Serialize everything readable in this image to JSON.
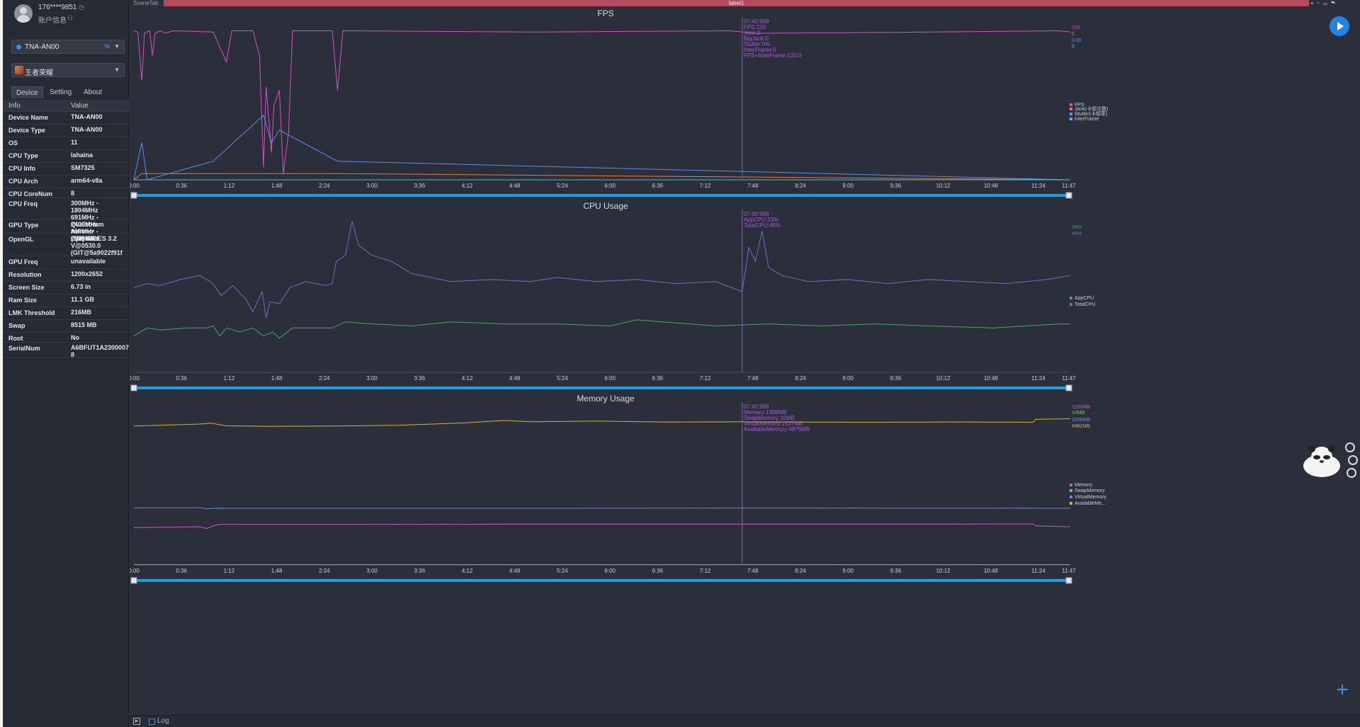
{
  "user": {
    "name": "176****9851",
    "subtitle": "账户信息"
  },
  "device_select": {
    "value": "TNA-AN00"
  },
  "game_select": {
    "value": "王者荣耀"
  },
  "tabs": [
    "Device",
    "Setting",
    "About"
  ],
  "info_table": {
    "headers": [
      "Info",
      "Value"
    ],
    "rows": [
      {
        "k": "Device Name",
        "v": "TNA-AN00",
        "h": 18
      },
      {
        "k": "Device Type",
        "v": "TNA-AN00",
        "h": 18
      },
      {
        "k": "OS",
        "v": "11",
        "h": 18
      },
      {
        "k": "CPU Type",
        "v": "lahaina",
        "h": 18
      },
      {
        "k": "CPU Info",
        "v": "SM7325",
        "h": 18
      },
      {
        "k": "CPU Arch",
        "v": "arm64-v8a",
        "h": 18
      },
      {
        "k": "CPU CoreNum",
        "v": "8",
        "h": 14
      },
      {
        "k": "CPU Freq",
        "v": "300MHz - 1804MHz\n691MHz - 2400MHz\n806MHz - 2515MHz",
        "h": 30
      },
      {
        "k": "GPU Type",
        "v": "Qualcomm Adreno\n(TM) 642L",
        "h": 20
      },
      {
        "k": "OpenGL",
        "v": "OpenGL ES 3.2\nV@0530.0\n(GIT@5a9022f91f",
        "h": 32
      },
      {
        "k": "GPU Freq",
        "v": "unavailable",
        "h": 18
      },
      {
        "k": "Resolution",
        "v": "1200x2652",
        "h": 18
      },
      {
        "k": "Screen Size",
        "v": "6.73 in",
        "h": 18
      },
      {
        "k": "Ram Size",
        "v": "11.1 GB",
        "h": 18
      },
      {
        "k": "LMK Threshold",
        "v": "216MB",
        "h": 18
      },
      {
        "k": "Swap",
        "v": "8515 MB",
        "h": 18
      },
      {
        "k": "Root",
        "v": "No",
        "h": 14
      },
      {
        "k": "SerialNum",
        "v": "A6BFUT1A2300007\n8",
        "h": 22
      }
    ]
  },
  "scene_tab": "SceneTab",
  "label_tab": "label1",
  "bottom": {
    "log_label": "Log"
  },
  "x_ticks": [
    "0:00",
    "0:36",
    "1:12",
    "1:48",
    "2:24",
    "3:00",
    "3:36",
    "4:12",
    "4:48",
    "5:24",
    "6:00",
    "6:36",
    "7:12",
    "7:48",
    "8:24",
    "9:00",
    "9:36",
    "10:12",
    "10:48",
    "11:24",
    "11:47"
  ],
  "chart_data": [
    {
      "type": "line",
      "title": "FPS",
      "ylabel": "FPS",
      "ylim": [
        0,
        130
      ],
      "yticks": [
        0,
        10,
        20,
        30,
        40,
        50,
        60,
        70,
        80,
        90,
        100,
        110,
        120,
        130
      ],
      "x_range": [
        "0:00",
        "11:47"
      ],
      "series": [
        {
          "name": "FPS",
          "color": "#d94fc8",
          "values": [
            [
              0,
              120
            ],
            [
              3,
              119
            ],
            [
              6,
              80
            ],
            [
              8,
              118
            ],
            [
              12,
              120
            ],
            [
              14,
              100
            ],
            [
              16,
              118
            ],
            [
              20,
              120
            ],
            [
              24,
              118
            ],
            [
              30,
              120
            ],
            [
              60,
              119
            ],
            [
              70,
              95
            ],
            [
              74,
              120
            ],
            [
              90,
              120
            ],
            [
              95,
              100
            ],
            [
              98,
              10
            ],
            [
              100,
              75
            ],
            [
              104,
              22
            ],
            [
              106,
              60
            ],
            [
              110,
              72
            ],
            [
              113,
              5
            ],
            [
              117,
              38
            ],
            [
              120,
              120
            ],
            [
              150,
              120
            ],
            [
              154,
              72
            ],
            [
              158,
              120
            ],
            [
              300,
              119
            ],
            [
              450,
              120
            ],
            [
              470,
              118
            ],
            [
              600,
              119
            ],
            [
              700,
              120
            ],
            [
              708,
              119
            ]
          ]
        },
        {
          "name": "Jank",
          "color": "#f07838",
          "values": [
            [
              0,
              0
            ],
            [
              6,
              5
            ],
            [
              10,
              5
            ],
            [
              60,
              5
            ],
            [
              98,
              5
            ],
            [
              110,
              5
            ],
            [
              154,
              5
            ],
            [
              708,
              0
            ]
          ]
        },
        {
          "name": "Stutter",
          "color": "#5c8cf0",
          "values": [
            [
              0,
              0
            ],
            [
              6,
              30
            ],
            [
              10,
              0
            ],
            [
              60,
              15
            ],
            [
              98,
              52
            ],
            [
              104,
              30
            ],
            [
              110,
              40
            ],
            [
              154,
              15
            ],
            [
              708,
              0
            ]
          ]
        },
        {
          "name": "InterFrame",
          "color": "#3ec0e0",
          "values": [
            [
              0,
              0
            ],
            [
              708,
              0
            ]
          ]
        }
      ],
      "legend": [
        "FPS",
        "Jank(卡顿次数)",
        "Stutter(卡顿率)",
        "InterFrame"
      ],
      "current_values": [
        {
          "text": "119",
          "color": "#d94fc8"
        },
        {
          "text": "0",
          "color": "#f07838"
        },
        {
          "text": "0.00",
          "color": "#5c8cf0"
        },
        {
          "text": "0",
          "color": "#3ec0e0"
        }
      ],
      "cursor": {
        "time": "7:40",
        "lines": [
          "07:40:999",
          "FPS:120",
          "Jank:0",
          "BigJank:0",
          "Stutter:0%",
          "InterFrame:0",
          "FPS+InterFrame:120.0"
        ]
      }
    },
    {
      "type": "line",
      "title": "CPU Usage",
      "ylabel": "%",
      "ylim": [
        0,
        80
      ],
      "yticks": [
        0,
        10,
        20,
        30,
        40,
        50,
        60,
        70,
        80
      ],
      "x_range": [
        "0:00",
        "11:47"
      ],
      "series": [
        {
          "name": "AppCPU",
          "color": "#3daa5c",
          "values": [
            [
              0,
              18
            ],
            [
              10,
              22
            ],
            [
              20,
              21
            ],
            [
              40,
              22
            ],
            [
              55,
              22
            ],
            [
              60,
              23
            ],
            [
              65,
              18
            ],
            [
              70,
              22
            ],
            [
              80,
              20
            ],
            [
              90,
              22
            ],
            [
              98,
              18
            ],
            [
              105,
              20
            ],
            [
              110,
              17
            ],
            [
              120,
              22
            ],
            [
              150,
              22
            ],
            [
              160,
              25
            ],
            [
              180,
              24
            ],
            [
              210,
              23
            ],
            [
              240,
              25
            ],
            [
              280,
              24
            ],
            [
              320,
              24
            ],
            [
              360,
              23
            ],
            [
              380,
              26
            ],
            [
              420,
              24
            ],
            [
              440,
              23
            ],
            [
              480,
              24
            ],
            [
              520,
              23
            ],
            [
              560,
              24
            ],
            [
              600,
              23
            ],
            [
              650,
              22
            ],
            [
              700,
              24
            ],
            [
              708,
              24
            ]
          ]
        },
        {
          "name": "TotalCPU",
          "color": "#6670c8",
          "values": [
            [
              0,
              42
            ],
            [
              10,
              44
            ],
            [
              20,
              43
            ],
            [
              35,
              46
            ],
            [
              50,
              48
            ],
            [
              60,
              44
            ],
            [
              66,
              38
            ],
            [
              75,
              43
            ],
            [
              85,
              36
            ],
            [
              90,
              30
            ],
            [
              97,
              40
            ],
            [
              100,
              27
            ],
            [
              103,
              35
            ],
            [
              110,
              34
            ],
            [
              118,
              42
            ],
            [
              130,
              45
            ],
            [
              145,
              43
            ],
            [
              150,
              44
            ],
            [
              153,
              55
            ],
            [
              160,
              58
            ],
            [
              165,
              75
            ],
            [
              170,
              63
            ],
            [
              180,
              58
            ],
            [
              195,
              55
            ],
            [
              210,
              49
            ],
            [
              240,
              45
            ],
            [
              270,
              46
            ],
            [
              300,
              45
            ],
            [
              320,
              47
            ],
            [
              350,
              45
            ],
            [
              380,
              46
            ],
            [
              410,
              44
            ],
            [
              440,
              45
            ],
            [
              460,
              40
            ],
            [
              465,
              62
            ],
            [
              470,
              55
            ],
            [
              475,
              70
            ],
            [
              480,
              52
            ],
            [
              490,
              48
            ],
            [
              510,
              45
            ],
            [
              540,
              46
            ],
            [
              570,
              44
            ],
            [
              600,
              46
            ],
            [
              630,
              45
            ],
            [
              660,
              44
            ],
            [
              690,
              46
            ],
            [
              708,
              48
            ]
          ]
        }
      ],
      "legend": [
        "AppCPU",
        "TotalCPU"
      ],
      "current_values": [
        {
          "text": "24%",
          "color": "#3daa5c"
        },
        {
          "text": "46%",
          "color": "#6670c8"
        }
      ],
      "cursor": {
        "time": "7:40",
        "lines": [
          "07:40:999",
          "AppCPU:23%",
          "TotalCPU:46%"
        ]
      }
    },
    {
      "type": "line",
      "title": "Memory Usage",
      "ylabel": "MB",
      "ylim": [
        0,
        5500
      ],
      "yticks": [
        0,
        500,
        1000,
        1500,
        2000,
        2500,
        3000,
        3500,
        4000,
        4500,
        5000,
        5500
      ],
      "x_range": [
        "0:00",
        "11:47"
      ],
      "series": [
        {
          "name": "Memory",
          "color": "#c85cc8",
          "values": [
            [
              0,
              1270
            ],
            [
              50,
              1300
            ],
            [
              55,
              1240
            ],
            [
              60,
              1330
            ],
            [
              65,
              1380
            ],
            [
              150,
              1380
            ],
            [
              300,
              1390
            ],
            [
              460,
              1390
            ],
            [
              600,
              1390
            ],
            [
              680,
              1395
            ],
            [
              682,
              1330
            ],
            [
              708,
              1300
            ]
          ]
        },
        {
          "name": "SwapMemory",
          "color": "#6cc84a",
          "values": [
            [
              0,
              10
            ],
            [
              708,
              10
            ]
          ]
        },
        {
          "name": "VirtualMemory",
          "color": "#5c8cf0",
          "values": [
            [
              0,
              1950
            ],
            [
              50,
              1950
            ],
            [
              55,
              1910
            ],
            [
              60,
              1930
            ],
            [
              300,
              1930
            ],
            [
              460,
              1937
            ],
            [
              708,
              1930
            ]
          ]
        },
        {
          "name": "AvailableMemory",
          "color": "#d4b036",
          "values": [
            [
              0,
              4730
            ],
            [
              20,
              4760
            ],
            [
              50,
              4800
            ],
            [
              58,
              4830
            ],
            [
              70,
              4740
            ],
            [
              100,
              4720
            ],
            [
              150,
              4730
            ],
            [
              200,
              4760
            ],
            [
              250,
              4840
            ],
            [
              280,
              4920
            ],
            [
              300,
              4880
            ],
            [
              350,
              4900
            ],
            [
              400,
              4870
            ],
            [
              460,
              4875
            ],
            [
              550,
              4860
            ],
            [
              620,
              4870
            ],
            [
              680,
              4860
            ],
            [
              682,
              4960
            ],
            [
              708,
              4982
            ]
          ]
        }
      ],
      "legend": [
        "Memory",
        "SwapMemory",
        "VirtualMemory",
        "AvailableMe..."
      ],
      "current_values": [
        {
          "text": "1290MB",
          "color": "#c85cc8"
        },
        {
          "text": "10MB",
          "color": "#6cc84a"
        },
        {
          "text": "1936MB",
          "color": "#5c8cf0"
        },
        {
          "text": "4982MB",
          "color": "#d4b036"
        }
      ],
      "cursor": {
        "time": "7:40",
        "lines": [
          "07:40:999",
          "Memory:1388MB",
          "SwapMemory:10MB",
          "VirtualMemory:1937MB",
          "AvailableMemory:4875MB"
        ]
      }
    }
  ]
}
